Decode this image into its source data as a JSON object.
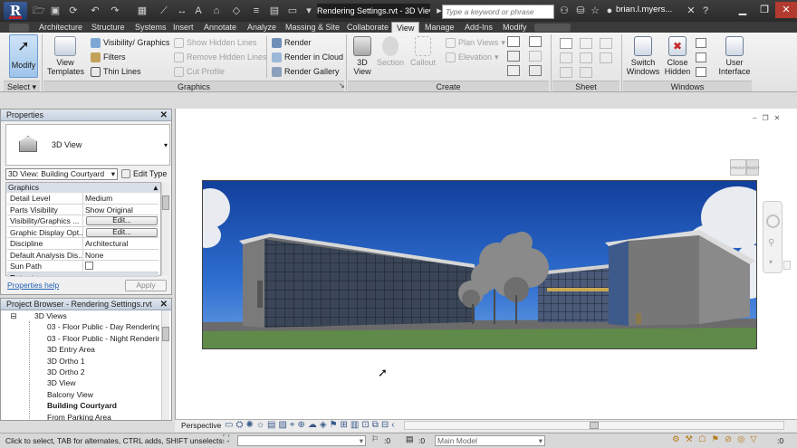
{
  "app": {
    "logo_letter": "R",
    "document_title": "Rendering Settings.rvt - 3D View:",
    "search_placeholder": "Type a keyword or phrase",
    "user": "brian.l.myers..."
  },
  "tabs": [
    "Architecture",
    "Structure",
    "Systems",
    "Insert",
    "Annotate",
    "Analyze",
    "Massing & Site",
    "Collaborate",
    "View",
    "Manage",
    "Add-Ins",
    "Modify"
  ],
  "active_tab": "View",
  "ribbon": {
    "select": {
      "modify": "Modify",
      "panel": "Select"
    },
    "graphics": {
      "panel": "Graphics",
      "view_templates": "View\nTemplates",
      "visibility": "Visibility/ Graphics",
      "filters": "Filters",
      "thin_lines": "Thin Lines",
      "show_hidden": "Show  Hidden Lines",
      "remove_hidden": "Remove  Hidden Lines",
      "cut_profile": "Cut  Profile",
      "render": "Render",
      "render_cloud": "Render  in Cloud",
      "render_gallery": "Render  Gallery"
    },
    "create": {
      "panel": "Create",
      "view3d": "3D\nView",
      "section": "Section",
      "callout": "Callout",
      "plan_views": "Plan  Views",
      "elevation": "Elevation"
    },
    "sheet": {
      "panel": "Sheet Composition"
    },
    "windows": {
      "panel": "Windows",
      "switch": "Switch\nWindows",
      "close_hidden": "Close\nHidden",
      "user_interface": "User\nInterface"
    }
  },
  "properties": {
    "title": "Properties",
    "type_name": "3D View",
    "view_selector": "3D View: Building Courtyard",
    "edit_type": "Edit Type",
    "section": "Graphics",
    "rows": [
      {
        "k": "Detail Level",
        "v": "Medium"
      },
      {
        "k": "Parts Visibility",
        "v": "Show Original"
      },
      {
        "k": "Visibility/Graphics ...",
        "v": "Edit..."
      },
      {
        "k": "Graphic Display Opt...",
        "v": "Edit..."
      },
      {
        "k": "Discipline",
        "v": "Architectural"
      },
      {
        "k": "Default Analysis Dis...",
        "v": "None"
      },
      {
        "k": "Sun Path",
        "v": ""
      },
      {
        "k": "Extents",
        "v": ""
      }
    ],
    "help": "Properties help",
    "apply": "Apply"
  },
  "browser": {
    "title": "Project Browser - Rendering Settings.rvt",
    "items": [
      {
        "label": "3D Views",
        "level": 0,
        "bold": false
      },
      {
        "label": "03 - Floor Public - Day Rendering",
        "level": 1,
        "bold": false
      },
      {
        "label": "03 - Floor Public - Night Rendering",
        "level": 1,
        "bold": false
      },
      {
        "label": "3D Entry Area",
        "level": 1,
        "bold": false
      },
      {
        "label": "3D Ortho 1",
        "level": 1,
        "bold": false
      },
      {
        "label": "3D Ortho 2",
        "level": 1,
        "bold": false
      },
      {
        "label": "3D View",
        "level": 1,
        "bold": false
      },
      {
        "label": "Balcony View",
        "level": 1,
        "bold": false
      },
      {
        "label": "Building Courtyard",
        "level": 1,
        "bold": true
      },
      {
        "label": "From Parking Area",
        "level": 1,
        "bold": false
      }
    ]
  },
  "viewcube": {
    "front": "FRONT",
    "right": "RIGHT"
  },
  "view_control": {
    "mode": "Perspective"
  },
  "status": {
    "hint": "Click to select, TAB for alternates, CTRL adds, SHIFT unselects.",
    "coord1": ":0",
    "coord2": ":0",
    "model": "Main Model"
  }
}
